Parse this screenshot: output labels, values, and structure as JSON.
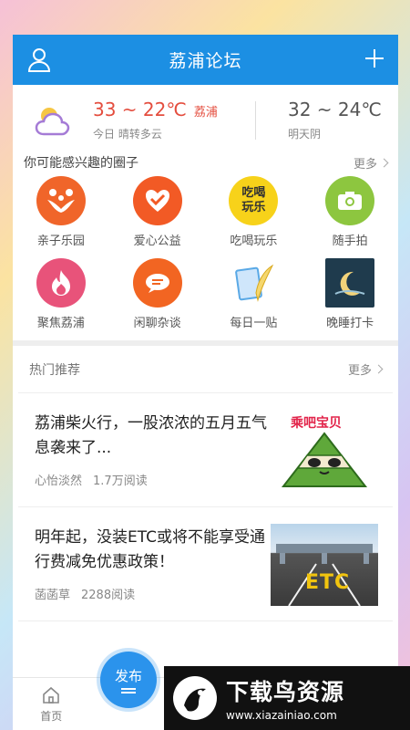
{
  "header": {
    "title": "荔浦论坛"
  },
  "weather": {
    "today_temp": "33 ~ 22℃",
    "city": "荔浦",
    "today_desc": "今日 晴转多云",
    "tomorrow_temp": "32 ~ 24℃",
    "tomorrow_desc": "明天阴"
  },
  "circles": {
    "title": "你可能感兴趣的圈子",
    "more": "更多",
    "items": [
      {
        "label": "亲子乐园",
        "icon": "family-icon",
        "color": "#f0652a"
      },
      {
        "label": "爱心公益",
        "icon": "heart-hand-icon",
        "color": "#f25a25"
      },
      {
        "label": "吃喝玩乐",
        "icon": "food-fun-icon",
        "color": "#f7d21a",
        "icon_text_1": "吃喝",
        "icon_text_2": "玩乐"
      },
      {
        "label": "随手拍",
        "icon": "camera-icon",
        "color": "#8dc63f"
      },
      {
        "label": "聚焦荔浦",
        "icon": "flame-icon",
        "color": "#e8537a"
      },
      {
        "label": "闲聊杂谈",
        "icon": "chat-icon",
        "color": "#f26522"
      },
      {
        "label": "每日一贴",
        "icon": "feather-note-icon",
        "color": "#5aa9e6"
      },
      {
        "label": "晚睡打卡",
        "icon": "moon-night-icon",
        "color": "#1f3b4d"
      }
    ]
  },
  "hot": {
    "title": "热门推荐",
    "more": "更多",
    "posts": [
      {
        "title": "荔浦柴火行，一股浓浓的五月五气息袭来了...",
        "author": "心怡淡然",
        "reads": "1.7万阅读",
        "image": "zongzi-icon",
        "image_text": "乘吧宝贝"
      },
      {
        "title": "明年起，没装ETC或将不能享受通行费减免优惠政策！",
        "author": "菡菡草",
        "reads": "2288阅读",
        "image": "etc-road-icon",
        "image_text": "ETC"
      }
    ]
  },
  "tabbar": {
    "home": "首页",
    "publish": "发布"
  },
  "watermark": {
    "big": "下载鸟资源",
    "small": "www.xiazainiao.com"
  }
}
